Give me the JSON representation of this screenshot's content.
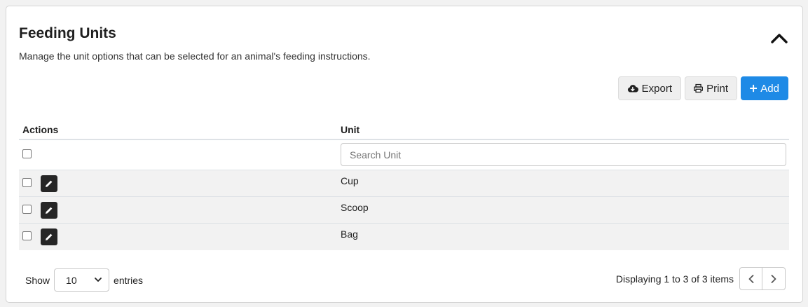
{
  "header": {
    "title": "Feeding Units",
    "subtitle": "Manage the unit options that can be selected for an animal's feeding instructions."
  },
  "toolbar": {
    "export_label": "Export",
    "print_label": "Print",
    "add_label": "Add",
    "add_color": "#1e8ae6"
  },
  "table": {
    "columns": [
      "Actions",
      "Unit"
    ],
    "search_placeholder": "Search Unit",
    "rows": [
      {
        "unit": "Cup"
      },
      {
        "unit": "Scoop"
      },
      {
        "unit": "Bag"
      }
    ]
  },
  "footer": {
    "show_label": "Show",
    "page_size": "10",
    "entries_label": "entries",
    "status": "Displaying 1 to 3 of 3 items"
  },
  "icons": {
    "collapse": "chevron-up-icon",
    "export": "cloud-download-icon",
    "print": "printer-icon",
    "add": "plus-icon",
    "edit": "pencil-icon",
    "prev": "chevron-left-icon",
    "next": "chevron-right-icon"
  }
}
